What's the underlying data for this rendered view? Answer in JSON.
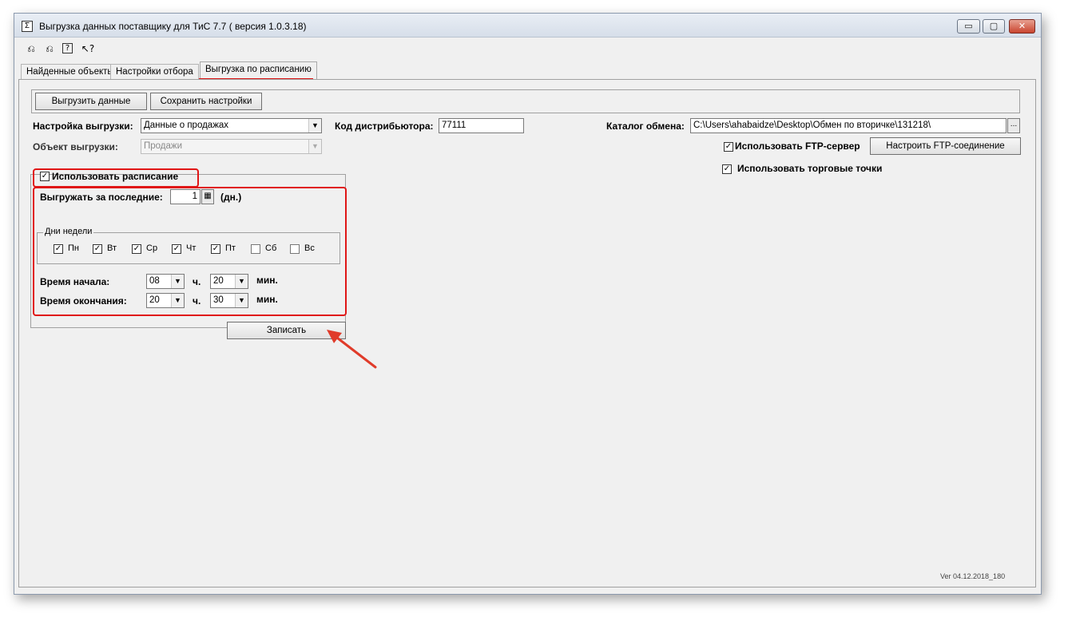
{
  "window": {
    "title": "Выгрузка данных поставщику для ТиС 7.7 ( версия 1.0.3.18)",
    "app_icon": "Σ",
    "controls": {
      "minimize": "▭",
      "maximize": "▢",
      "close": "✕"
    }
  },
  "toolbar": {
    "icons": [
      "connect-icon",
      "disconnect-icon",
      "help-icon",
      "context-help-icon"
    ],
    "glyphs": [
      "⎌",
      "⎌",
      "?",
      "↖?"
    ]
  },
  "tabs": [
    {
      "label": "Найденные объекты"
    },
    {
      "label": "Настройки отбора"
    },
    {
      "label": "Выгрузка по расписанию",
      "active": true
    }
  ],
  "actions": {
    "export_label": "Выгрузить данные",
    "save_settings_label": "Сохранить настройки"
  },
  "settings": {
    "setup_label": "Настройка выгрузки:",
    "setup_value": "Данные о продажах",
    "object_label": "Объект выгрузки:",
    "object_value": "Продажи",
    "distributor_label": "Код дистрибьютора:",
    "distributor_value": "77111",
    "catalog_label": "Каталог обмена:",
    "catalog_value": "C:\\Users\\ahabaidze\\Desktop\\Обмен по вторичке\\131218\\",
    "browse_label": "...",
    "use_ftp_label": "Использовать FTP-сервер",
    "use_ftp_checked": true,
    "ftp_setup_label": "Настроить FTP-соединение",
    "use_points_label": "Использовать торговые точки",
    "use_points_checked": true
  },
  "schedule": {
    "use_schedule_label": "Использовать расписание",
    "use_schedule_checked": true,
    "last_days_label": "Выгружать за последние:",
    "last_days_value": "1",
    "days_unit": "(дн.)",
    "weekdays_legend": "Дни недели",
    "weekdays": [
      {
        "label": "Пн",
        "checked": true
      },
      {
        "label": "Вт",
        "checked": true
      },
      {
        "label": "Ср",
        "checked": true
      },
      {
        "label": "Чт",
        "checked": true
      },
      {
        "label": "Пт",
        "checked": true
      },
      {
        "label": "Сб",
        "checked": false
      },
      {
        "label": "Вс",
        "checked": false
      }
    ],
    "start_label": "Время начала:",
    "start_hour": "08",
    "start_minute": "20",
    "end_label": "Время окончания:",
    "end_hour": "20",
    "end_minute": "30",
    "hour_unit": "ч.",
    "minute_unit": "мин.",
    "save_label": "Записать"
  },
  "footer": {
    "version": "Ver 04.12.2018_180"
  },
  "colors": {
    "annotation_red": "#e01616",
    "window_bg": "#f0f0f0"
  }
}
